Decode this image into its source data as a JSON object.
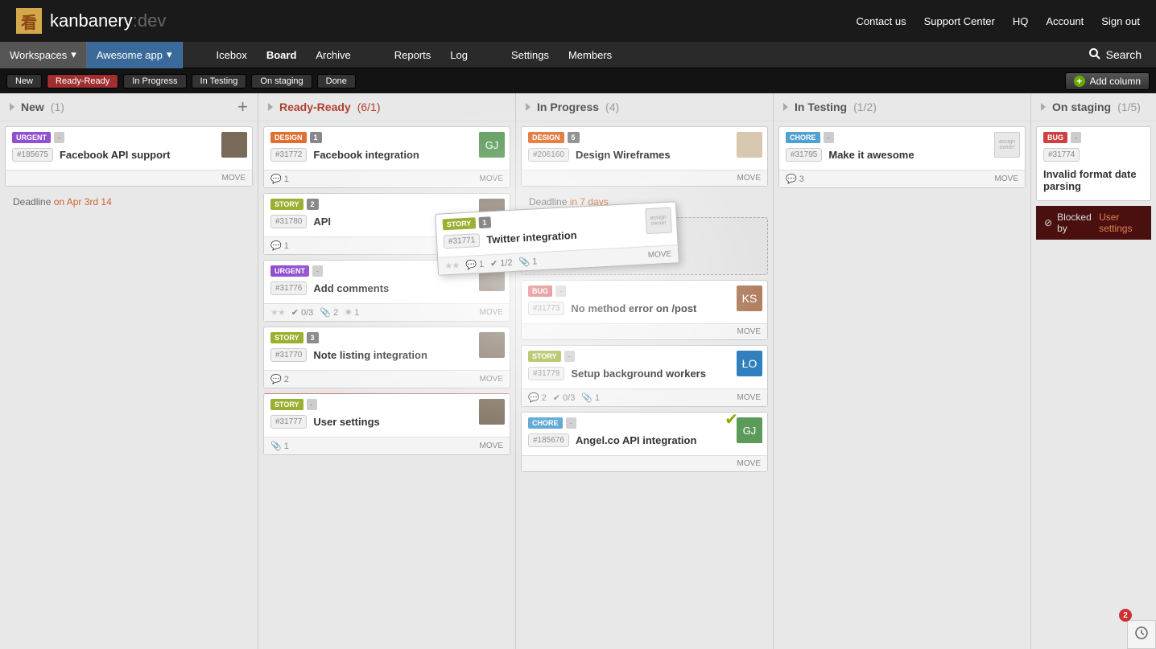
{
  "brand": {
    "name": "kanbanery",
    "suffix": ":dev"
  },
  "topLinks": [
    "Contact us",
    "Support Center",
    "HQ",
    "Account",
    "Sign out"
  ],
  "menu": {
    "workspaces": "Workspaces",
    "app": "Awesome app",
    "items": [
      "Icebox",
      "Board",
      "Archive",
      "Reports",
      "Log",
      "Settings",
      "Members"
    ],
    "search": "Search"
  },
  "filters": [
    "New",
    "Ready-Ready",
    "In Progress",
    "In Testing",
    "On staging",
    "Done"
  ],
  "addColumn": "Add column",
  "columns": {
    "new": {
      "name": "New",
      "count": "(1)"
    },
    "ready": {
      "name": "Ready-Ready",
      "count": "(6/1)"
    },
    "progress": {
      "name": "In Progress",
      "count": "(4)"
    },
    "testing": {
      "name": "In Testing",
      "count": "(1/2)"
    },
    "staging": {
      "name": "On staging",
      "count": "(1/5)"
    }
  },
  "cards": {
    "new0": {
      "tag": "URGENT",
      "est": "-",
      "ticket": "#185675",
      "title": "Facebook API support"
    },
    "newDeadline": {
      "label": "Deadline",
      "when": "on Apr 3rd 14"
    },
    "r0": {
      "tag": "DESIGN",
      "est": "1",
      "ticket": "#31772",
      "title": "Facebook integration",
      "comments": "1"
    },
    "r1": {
      "tag": "STORY",
      "est": "2",
      "ticket": "#31780",
      "title": "API",
      "comments": "1"
    },
    "r2": {
      "tag": "URGENT",
      "est": "-",
      "ticket": "#31776",
      "title": "Add comments",
      "subtasks": "0/3",
      "attach": "2",
      "block": "1"
    },
    "r3": {
      "tag": "STORY",
      "est": "3",
      "ticket": "#31770",
      "title": "Note listing integration",
      "comments": "2"
    },
    "r4": {
      "tag": "STORY",
      "est": "-",
      "ticket": "#31777",
      "title": "User settings",
      "attach": "1"
    },
    "p0": {
      "tag": "DESIGN",
      "est": "5",
      "ticket": "#206160",
      "title": "Design Wireframes"
    },
    "pDeadline": {
      "label": "Deadline",
      "when": "in 7 days"
    },
    "p1": {
      "tag": "BUG",
      "est": "-",
      "ticket": "#31773",
      "title": "No method error on /post"
    },
    "p2": {
      "tag": "STORY",
      "est": "-",
      "ticket": "#31779",
      "title": "Setup background workers",
      "comments": "2",
      "subtasks": "0/3",
      "attach": "1"
    },
    "p3": {
      "tag": "CHORE",
      "est": "-",
      "ticket": "#185676",
      "title": "Angel.co API integration"
    },
    "t0": {
      "tag": "CHORE",
      "est": "-",
      "ticket": "#31795",
      "title": "Make it awesome",
      "comments": "3"
    },
    "s0": {
      "tag": "BUG",
      "est": "-",
      "ticket": "#31774",
      "title": "Invalid format date parsing"
    },
    "sBlocked": {
      "label": "Blocked by",
      "by": "User settings"
    },
    "drag": {
      "tag": "STORY",
      "est": "1",
      "ticket": "#31771",
      "title": "Twitter integration",
      "comments": "1",
      "subtasks": "1/2",
      "attach": "1"
    }
  },
  "move": "MOVE",
  "assign": "assign owner",
  "cornerBadge": "2"
}
